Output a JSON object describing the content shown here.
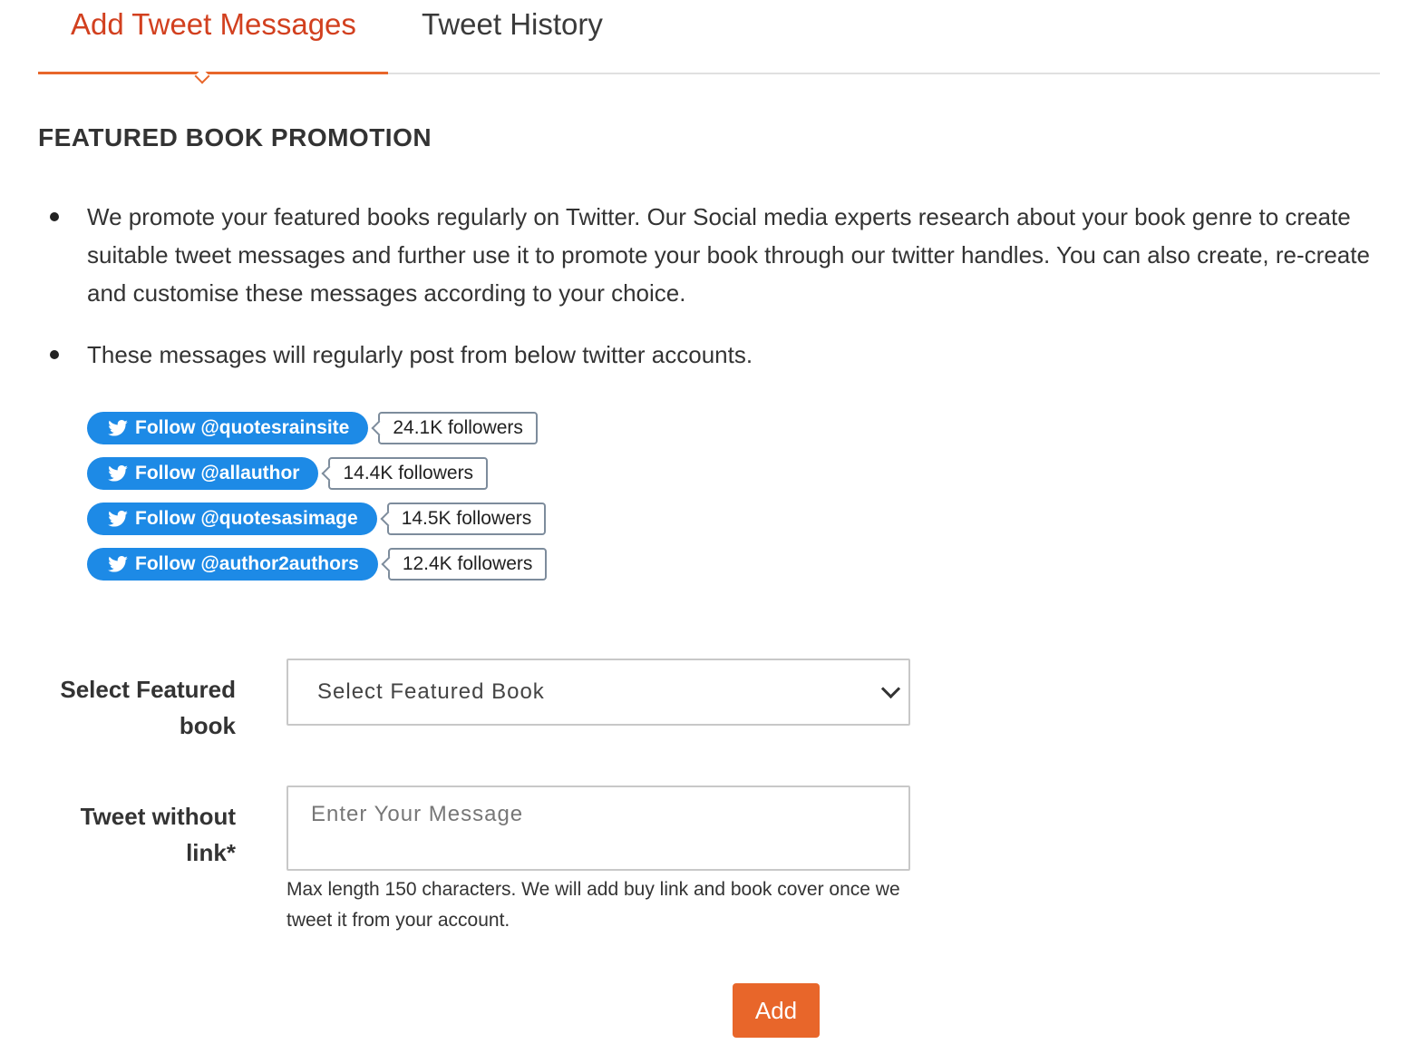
{
  "tabs": [
    {
      "label": "Add Tweet Messages",
      "active": true
    },
    {
      "label": "Tweet History",
      "active": false
    }
  ],
  "section_title": "FEATURED BOOK PROMOTION",
  "bullets": [
    "We promote your featured books regularly on Twitter. Our Social media experts research about your book genre to create suitable tweet messages and further use it to promote your book through our twitter handles. You can also create, re-create and customise these messages according to your choice.",
    "These messages will regularly post from below twitter accounts."
  ],
  "twitter_accounts": [
    {
      "button_label": "Follow @quotesrainsite",
      "followers": "24.1K followers"
    },
    {
      "button_label": "Follow @allauthor",
      "followers": "14.4K followers"
    },
    {
      "button_label": "Follow @quotesasimage",
      "followers": "14.5K followers"
    },
    {
      "button_label": "Follow @author2authors",
      "followers": "12.4K followers"
    }
  ],
  "form": {
    "book_label": "Select Featured book",
    "book_select_value": "Select Featured Book",
    "tweet_label": "Tweet without link*",
    "tweet_placeholder": "Enter Your Message",
    "tweet_value": "",
    "help_text": "Max length 150 characters. We will add buy link and book cover once we tweet it from your account.",
    "submit_label": "Add"
  },
  "colors": {
    "accent": "#e8662a",
    "active_tab_text": "#d2401f",
    "twitter_blue": "#1d8ae6"
  }
}
